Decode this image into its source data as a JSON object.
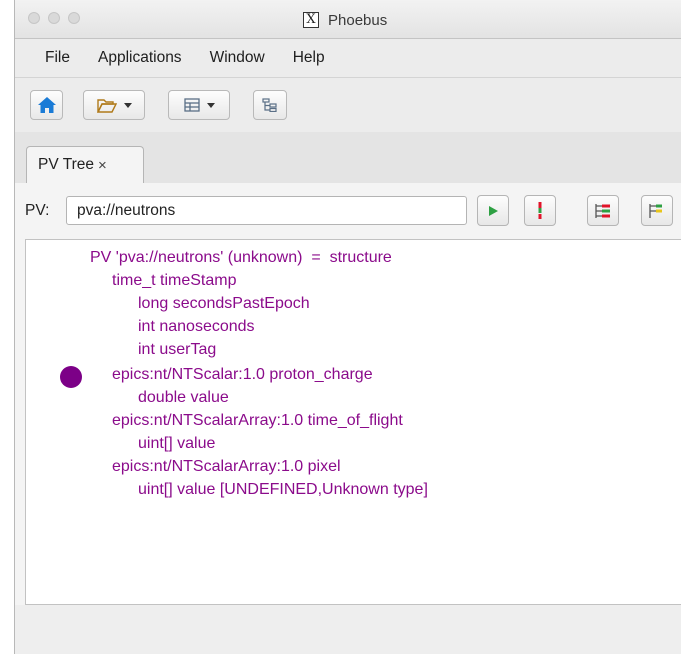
{
  "window": {
    "title": "Phoebus"
  },
  "menu": {
    "items": [
      "File",
      "Applications",
      "Window",
      "Help"
    ]
  },
  "toolbar": {
    "buttons": [
      {
        "icon": "home-icon",
        "has_dropdown": false
      },
      {
        "icon": "folder-open-icon",
        "has_dropdown": true
      },
      {
        "icon": "layout-icon",
        "has_dropdown": true
      },
      {
        "icon": "tree-icon",
        "has_dropdown": false
      }
    ]
  },
  "tab": {
    "label": "PV Tree",
    "close_glyph": "×"
  },
  "pv": {
    "label": "PV:",
    "value": "pva://neutrons"
  },
  "actions": [
    {
      "icon": "play-icon"
    },
    {
      "icon": "alarm-trigger-icon"
    },
    {
      "icon": "expand-tree-icon"
    },
    {
      "icon": "collapse-tree-icon"
    }
  ],
  "tree": {
    "lines": [
      "PV 'pva://neutrons' (unknown)  =  structure",
      "time_t timeStamp",
      "long secondsPastEpoch",
      "int nanoseconds",
      "int userTag",
      "epics:nt/NTScalar:1.0 proton_charge",
      "double value",
      "epics:nt/NTScalarArray:1.0 time_of_flight",
      "uint[] value",
      "epics:nt/NTScalarArray:1.0 pixel",
      "uint[] value [UNDEFINED,Unknown type]"
    ],
    "alarm_color": "#7c0087",
    "text_color": "#8b0b8b"
  }
}
